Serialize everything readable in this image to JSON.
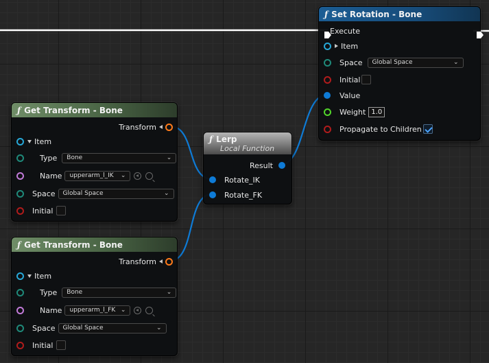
{
  "colors": {
    "exec": "#ffffff",
    "struct": "#0e7bd6",
    "struct_ring": "#27a8d8",
    "transform": "#ff7b1a",
    "byte": "#1f8a7a",
    "name": "#c27bd9",
    "bool": "#b01c1c",
    "float": "#52d62a"
  },
  "set_rotation": {
    "title": "Set Rotation - Bone",
    "execute_label": "Execute",
    "item_label": "Item",
    "space_label": "Space",
    "space_value": "Global Space",
    "initial_label": "Initial",
    "value_label": "Value",
    "weight_label": "Weight",
    "weight_value": "1.0",
    "propagate_label": "Propagate to Children",
    "initial_checked": false,
    "propagate_checked": true
  },
  "lerp": {
    "title": "Lerp",
    "subtitle": "Local Function",
    "result_label": "Result",
    "input_a_label": "Rotate_IK",
    "input_b_label": "Rotate_FK"
  },
  "get_transform_1": {
    "title": "Get Transform - Bone",
    "output_label": "Transform",
    "item_label": "Item",
    "type_label": "Type",
    "type_value": "Bone",
    "name_label": "Name",
    "name_value": "upperarm_l_IK",
    "space_label": "Space",
    "space_value": "Global Space",
    "initial_label": "Initial"
  },
  "get_transform_2": {
    "title": "Get Transform - Bone",
    "output_label": "Transform",
    "item_label": "Item",
    "type_label": "Type",
    "type_value": "Bone",
    "name_label": "Name",
    "name_value": "upperarm_l_FK",
    "space_label": "Space",
    "space_value": "Global Space",
    "initial_label": "Initial"
  },
  "icons": {
    "function": "function-icon",
    "exec_pin": "exec-pin-icon",
    "struct_pin": "struct-pin-icon",
    "expand": "expand-arrow-icon",
    "dropdown": "chevron-down-icon",
    "browse": "browse-arrow-icon",
    "search": "search-icon",
    "check": "check-icon"
  }
}
